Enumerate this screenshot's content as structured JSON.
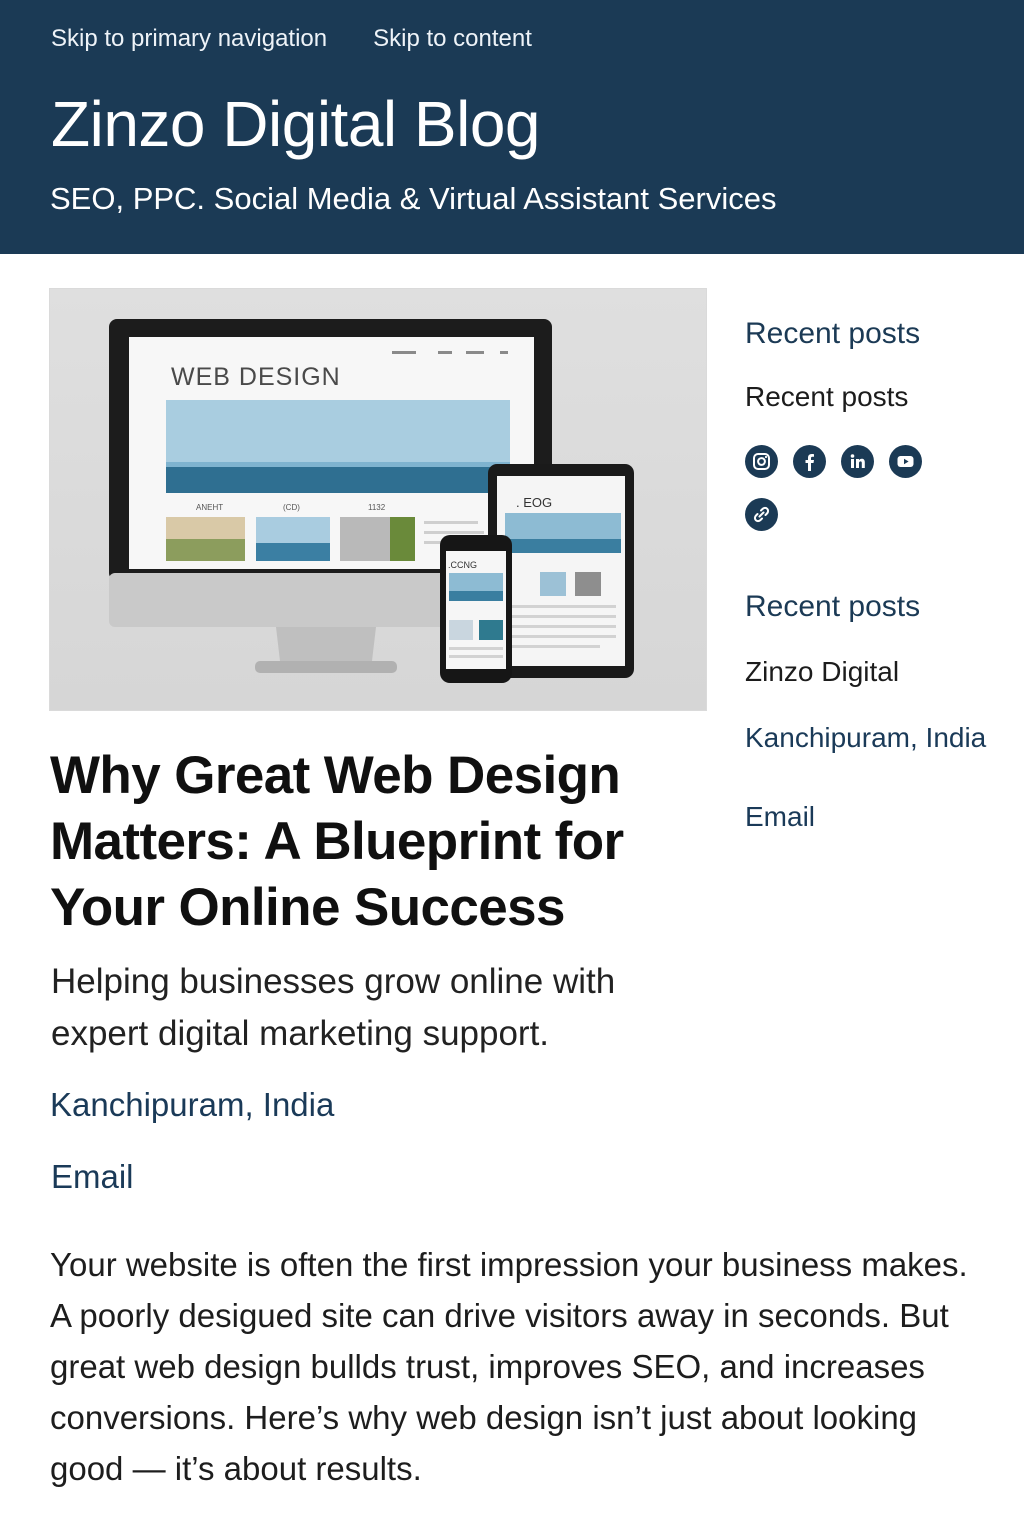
{
  "header": {
    "skip_nav": "Skip to primary navigation",
    "skip_content": "Skip to content",
    "site_title": "Zinzo Digital Blog",
    "tagline": "SEO, PPC. Social Media & Virtual Assistant Services"
  },
  "hero_image": {
    "desktop_heading": "WEB DESIGN",
    "desktop_captions": [
      "ANEHT",
      "(CD)",
      "1132"
    ],
    "tablet_heading": ". EOG",
    "phone_heading": ".CCNG"
  },
  "post": {
    "title": "Why Great Web Design Matters: A Blueprint for Your Online Success",
    "intro": "Helping businesses grow online with expert digital marketing support.",
    "location": "Kanchipuram, India",
    "email": "Email",
    "body": "Your website is often the first impression your business makes. A poorly desigued site can drive visitors away in seconds. But great web design bullds trust, improves SEO, and increases conversions. Here’s why web design isn’t just about looking good — it’s about results."
  },
  "sidebar": {
    "widget1_title": "Recent posts",
    "widget1_text": "Recent posts",
    "social_icons": [
      "instagram-icon",
      "facebook-icon",
      "linkedin-icon",
      "youtube-icon",
      "link-icon"
    ],
    "widget2_title": "Recent posts",
    "company": "Zinzo Digital",
    "location": "Kanchipuram, India",
    "email": "Email"
  },
  "colors": {
    "header_bg": "#1b3a55",
    "accent": "#1b3a55",
    "link": "#1a3a58"
  }
}
